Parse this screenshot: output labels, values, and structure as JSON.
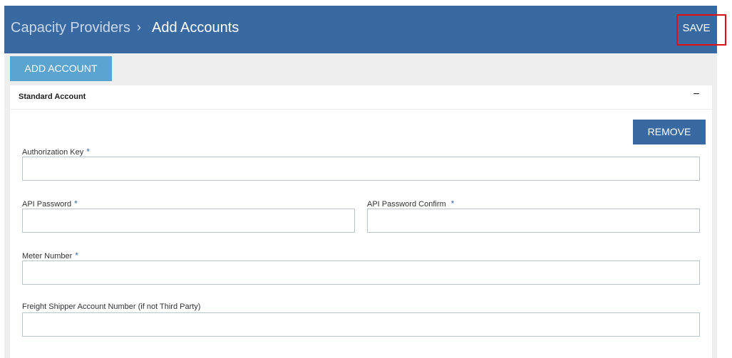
{
  "header": {
    "breadcrumb_parent": "Capacity Providers",
    "breadcrumb_separator": "›",
    "breadcrumb_current": "Add Accounts",
    "save_label": "SAVE"
  },
  "toolbar": {
    "add_account_label": "ADD ACCOUNT"
  },
  "account_card": {
    "title": "Standard Account",
    "collapse_icon": "minus-icon",
    "remove_label": "REMOVE",
    "fields": {
      "authorization_key": {
        "label": "Authorization Key",
        "required": "*",
        "value": "",
        "placeholder": ""
      },
      "api_password": {
        "label": "API Password",
        "required": "*",
        "value": "",
        "placeholder": ""
      },
      "api_password_confirm": {
        "label": "API Password Confirm",
        "required": "*",
        "value": "",
        "placeholder": ""
      },
      "meter_number": {
        "label": "Meter Number",
        "required": "*",
        "value": "",
        "placeholder": ""
      },
      "freight_shipper_account_number": {
        "label": "Freight Shipper Account Number (if not Third Party)",
        "value": "",
        "placeholder": ""
      }
    }
  },
  "colors": {
    "header_bg": "#3869a0",
    "add_button_bg": "#5ba4d0",
    "remove_button_bg": "#3869a0",
    "required_marker": "#3869a0",
    "highlight_box": "#e01010"
  }
}
